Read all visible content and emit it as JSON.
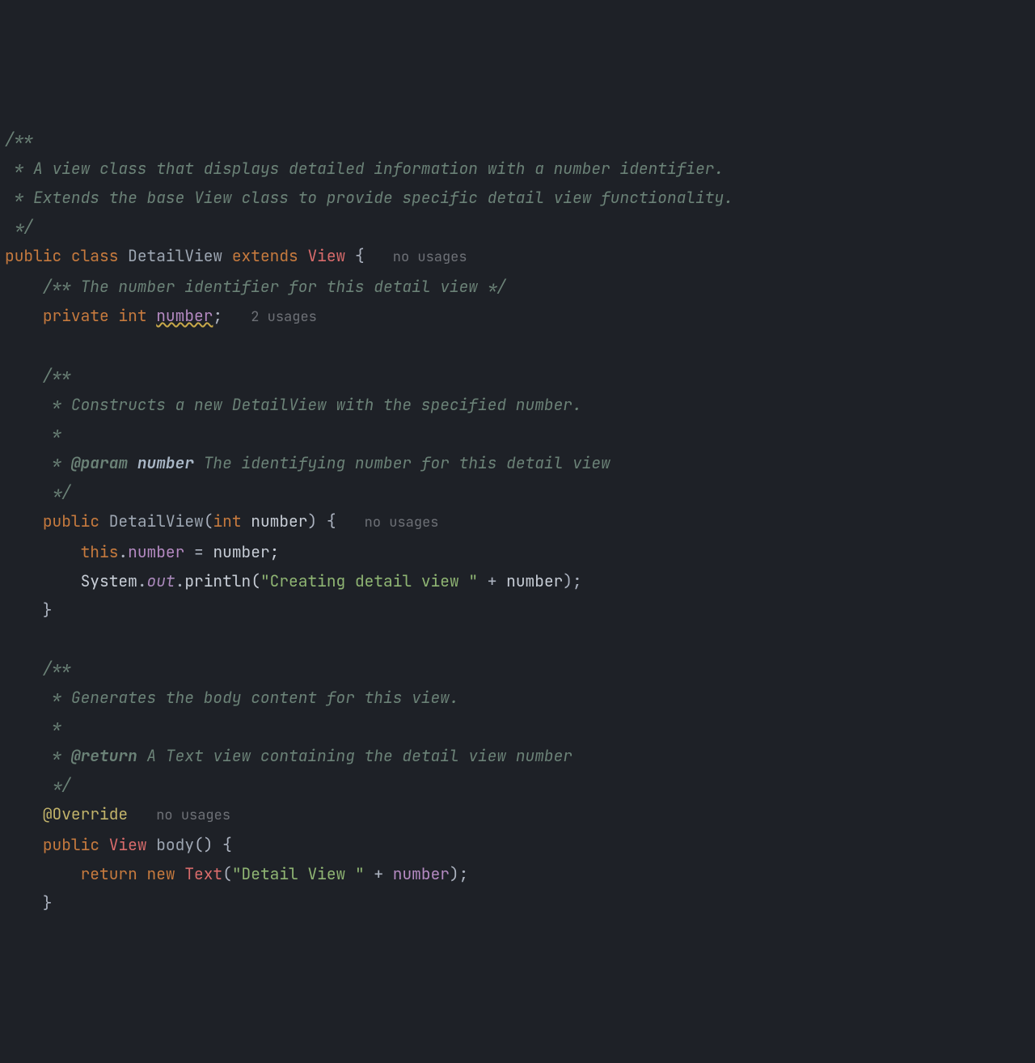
{
  "lines": {
    "l1": "/**",
    "l2": " * A view class that displays detailed information with a number identifier.",
    "l3": " * Extends the base View class to provide specific detail view functionality.",
    "l4": " */",
    "l5_public": "public",
    "l5_class": "class",
    "l5_name": "DetailView",
    "l5_extends": "extends",
    "l5_super": "View",
    "l5_brace": " {",
    "l5_hint": "no usages",
    "l6": "    /** The number identifier for this detail view */",
    "l7_priv": "private",
    "l7_int": "int",
    "l7_num": "number",
    "l7_semi": ";",
    "l7_hint": "2 usages",
    "l9": "    /**",
    "l10": "     * Constructs a new DetailView with the specified number.",
    "l11": "     *",
    "l12_star": "     * ",
    "l12_tag": "@param",
    "l12_name": "number",
    "l12_rest": " The identifying number for this detail view",
    "l13": "     */",
    "l14_pub": "public",
    "l14_name": "DetailView",
    "l14_open": "(",
    "l14_int": "int",
    "l14_param": "number",
    "l14_close": ") {",
    "l14_hint": "no usages",
    "l15_this": "this",
    "l15_dot": ".",
    "l15_field": "number",
    "l15_eq": " = ",
    "l15_rhs": "number;",
    "l16_sys": "System",
    "l16_d1": ".",
    "l16_out": "out",
    "l16_d2": ".",
    "l16_println": "println(",
    "l16_str": "\"Creating detail view \"",
    "l16_plus": " + ",
    "l16_num": "number",
    "l16_end": ");",
    "l17": "    }",
    "l19": "    /**",
    "l20": "     * Generates the body content for this view.",
    "l21": "     *",
    "l22_star": "     * ",
    "l22_tag": "@return",
    "l22_rest": " A Text view containing the detail view number",
    "l23": "     */",
    "l24_anno": "@Override",
    "l24_hint": "no usages",
    "l25_pub": "public",
    "l25_type": "View",
    "l25_name": "body",
    "l25_rest": "() {",
    "l26_ret": "return",
    "l26_new": "new",
    "l26_text": "Text",
    "l26_open": "(",
    "l26_str": "\"Detail View \"",
    "l26_plus": " + ",
    "l26_num": "number",
    "l26_end": ");",
    "l27": "    }"
  }
}
